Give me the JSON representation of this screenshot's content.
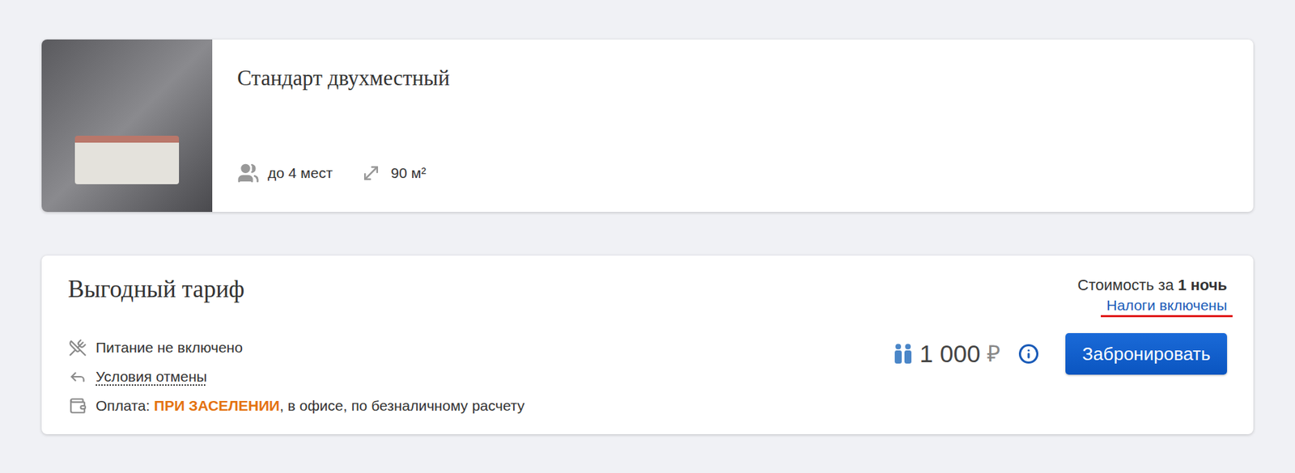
{
  "room": {
    "title": "Стандарт двухместный",
    "capacity": "до 4 мест",
    "area": "90 м²"
  },
  "tariff": {
    "name": "Выгодный тариф",
    "price_header": {
      "label": "Стоимость за",
      "nights": "1 ночь"
    },
    "taxes_link": {
      "label": "Налоги включены",
      "annotated": true
    },
    "features": [
      {
        "kind": "meal",
        "text": "Питание не включено"
      },
      {
        "kind": "cancel",
        "text": "Условия отмены"
      },
      {
        "kind": "payment",
        "label": "Оплата:",
        "highlight": "ПРИ ЗАСЕЛЕНИИ",
        "text": ", в офисе, по безналичному расчету"
      }
    ],
    "price": "1 000",
    "currency": "₽",
    "button": "Забронировать"
  }
}
